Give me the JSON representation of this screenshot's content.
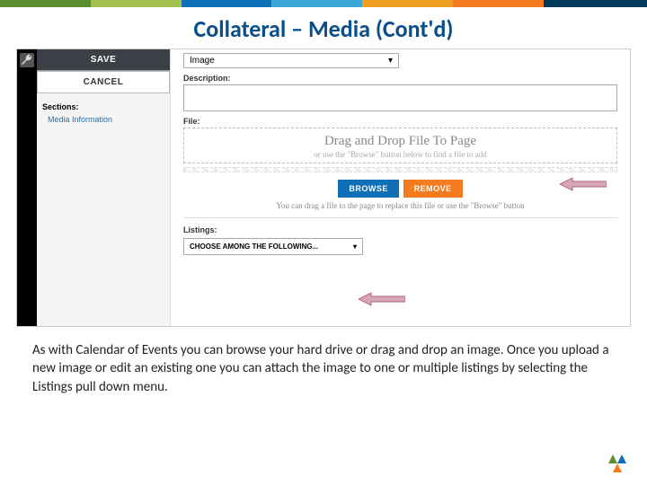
{
  "title": "Collateral – Media (Cont'd)",
  "left": {
    "save": "SAVE",
    "cancel": "CANCEL",
    "sections_label": "Sections:",
    "media_info": "Media Information"
  },
  "form": {
    "type_value": "Image",
    "desc_label": "Description:",
    "file_label": "File:",
    "dropzone_title": "Drag and Drop File To Page",
    "dropzone_sub": "or use the \"Browse\" button below to find a file to add",
    "browse": "BROWSE",
    "remove": "REMOVE",
    "replace_hint": "You can drag a file to the page to replace this file or use the \"Browse\" button",
    "listings_label": "Listings:",
    "listings_dd": "CHOOSE AMONG THE FOLLOWING..."
  },
  "caption": "As with Calendar of Events you can browse your hard drive or drag and drop an image. Once you upload a new image or edit an existing one you can attach the image to one or multiple listings by selecting the Listings pull down menu."
}
